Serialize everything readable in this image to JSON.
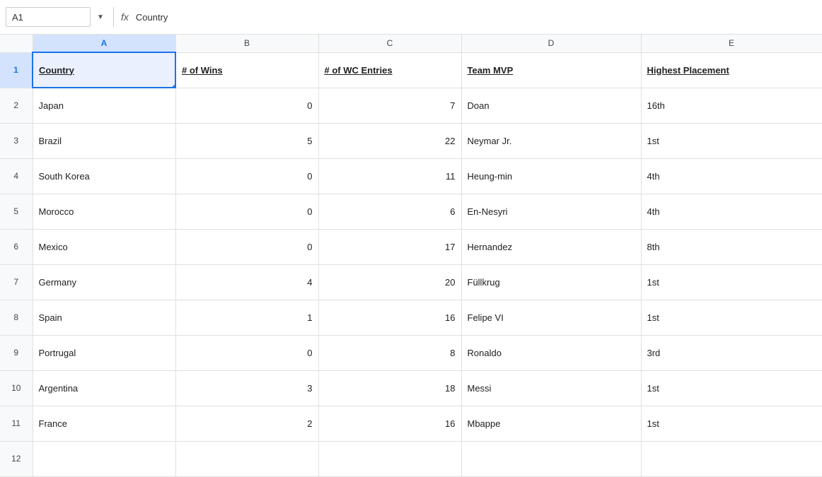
{
  "formulaBar": {
    "cellRef": "A1",
    "dropdownIcon": "▼",
    "fxLabel": "fx",
    "formulaValue": "Country"
  },
  "columns": {
    "rowHeader": "",
    "a": "A",
    "b": "B",
    "c": "C",
    "d": "D",
    "e": "E"
  },
  "headers": {
    "country": "Country",
    "wins": "# of Wins",
    "wcEntries": "# of WC Entries",
    "teamMvp": "Team MVP",
    "highestPlacement": "Highest Placement"
  },
  "rows": [
    {
      "rowNum": "2",
      "country": "Japan",
      "wins": "0",
      "wcEntries": "7",
      "teamMvp": "Doan",
      "highestPlacement": "16th"
    },
    {
      "rowNum": "3",
      "country": "Brazil",
      "wins": "5",
      "wcEntries": "22",
      "teamMvp": "Neymar Jr.",
      "highestPlacement": "1st"
    },
    {
      "rowNum": "4",
      "country": "South Korea",
      "wins": "0",
      "wcEntries": "11",
      "teamMvp": "Heung-min",
      "highestPlacement": "4th"
    },
    {
      "rowNum": "5",
      "country": "Morocco",
      "wins": "0",
      "wcEntries": "6",
      "teamMvp": "En-Nesyri",
      "highestPlacement": "4th"
    },
    {
      "rowNum": "6",
      "country": "Mexico",
      "wins": "0",
      "wcEntries": "17",
      "teamMvp": "Hernandez",
      "highestPlacement": "8th"
    },
    {
      "rowNum": "7",
      "country": "Germany",
      "wins": "4",
      "wcEntries": "20",
      "teamMvp": "Füllkrug",
      "highestPlacement": "1st"
    },
    {
      "rowNum": "8",
      "country": "Spain",
      "wins": "1",
      "wcEntries": "16",
      "teamMvp": "Felipe VI",
      "highestPlacement": "1st"
    },
    {
      "rowNum": "9",
      "country": "Portrugal",
      "wins": "0",
      "wcEntries": "8",
      "teamMvp": "Ronaldo",
      "highestPlacement": "3rd"
    },
    {
      "rowNum": "10",
      "country": "Argentina",
      "wins": "3",
      "wcEntries": "18",
      "teamMvp": "Messi",
      "highestPlacement": "1st"
    },
    {
      "rowNum": "11",
      "country": "France",
      "wins": "2",
      "wcEntries": "16",
      "teamMvp": "Mbappe",
      "highestPlacement": "1st"
    },
    {
      "rowNum": "12",
      "country": "",
      "wins": "",
      "wcEntries": "",
      "teamMvp": "",
      "highestPlacement": ""
    }
  ]
}
